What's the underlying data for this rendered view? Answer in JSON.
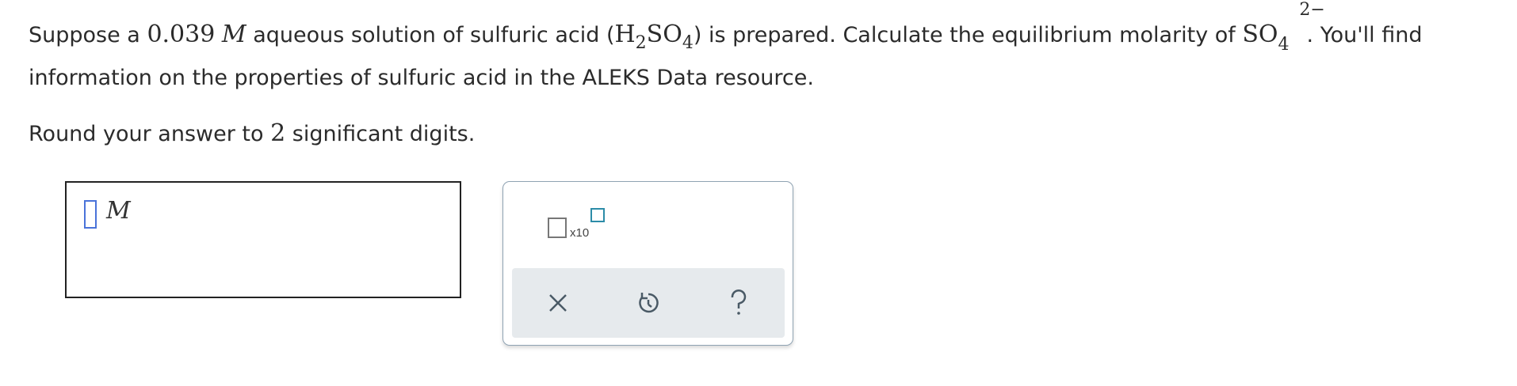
{
  "question": {
    "p1_a": "Suppose a ",
    "concentration": "0.039",
    "unit_M": "M",
    "p1_b": " aqueous solution of sulfuric acid (",
    "formula_H": "H",
    "formula_H_sub": "2",
    "formula_SO": "SO",
    "formula_SO_sub": "4",
    "p1_c": ") is prepared. Calculate the equilibrium molarity of ",
    "ion_SO": "SO",
    "ion_sub": "4",
    "ion_charge": "2−",
    "p1_d": ". You'll find information on the properties of sulfuric acid in the ALEKS Data resource.",
    "p2_a": "Round your answer to ",
    "sig_figs": "2",
    "p2_b": " significant digits."
  },
  "answer": {
    "value": "",
    "unit": "M"
  },
  "toolbox": {
    "sci_notation_label": "x10",
    "icons": {
      "clear": "close-icon",
      "undo": "undo-icon",
      "help": "help-icon"
    },
    "accent_color": "#2c8ca8",
    "icon_color": "#4a5a66"
  }
}
